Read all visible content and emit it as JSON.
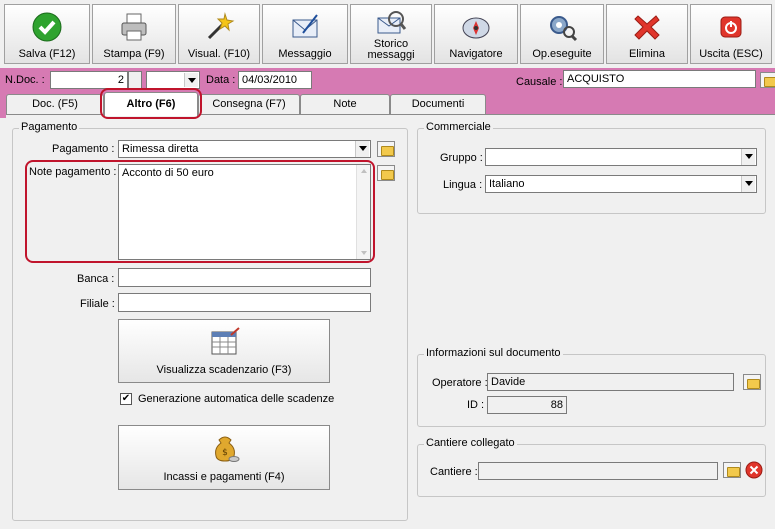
{
  "toolbar": {
    "buttons": [
      {
        "label": "Salva (F12)",
        "icon": "green-check-icon"
      },
      {
        "label": "Stampa (F9)",
        "icon": "printer-icon"
      },
      {
        "label": "Visual. (F10)",
        "icon": "magic-wand-icon"
      },
      {
        "label": "Messaggio",
        "icon": "envelope-icon"
      },
      {
        "label": "Storico\nmessaggi",
        "icon": "message-history-icon"
      },
      {
        "label": "Navigatore",
        "icon": "compass-icon"
      },
      {
        "label": "Op.eseguite",
        "icon": "gears-search-icon"
      },
      {
        "label": "Elimina",
        "icon": "red-x-icon"
      },
      {
        "label": "Uscita (ESC)",
        "icon": "exit-power-icon"
      }
    ]
  },
  "header": {
    "ndoc_label": "N.Doc. :",
    "ndoc_value": "2",
    "data_label": "Data :",
    "data_value": "04/03/2010",
    "causale_label": "Causale :",
    "causale_value": "ACQUISTO"
  },
  "tabs": [
    {
      "label": "Doc. (F5)"
    },
    {
      "label": "Altro (F6)"
    },
    {
      "label": "Consegna (F7)"
    },
    {
      "label": "Note"
    },
    {
      "label": "Documenti"
    }
  ],
  "pagamento": {
    "title": "Pagamento",
    "pagamento_label": "Pagamento :",
    "pagamento_value": "Rimessa diretta",
    "note_label": "Note pagamento :",
    "note_value": "Acconto di 50 euro",
    "banca_label": "Banca :",
    "banca_value": "",
    "filiale_label": "Filiale :",
    "filiale_value": "",
    "scadenzario_button": "Visualizza scadenzario (F3)",
    "generazione_label": "Generazione automatica delle scadenze",
    "generazione_checked": true,
    "incassi_button": "Incassi e pagamenti (F4)"
  },
  "commerciale": {
    "title": "Commerciale",
    "gruppo_label": "Gruppo :",
    "gruppo_value": "",
    "lingua_label": "Lingua :",
    "lingua_value": "Italiano"
  },
  "informazioni": {
    "title": "Informazioni sul documento",
    "operatore_label": "Operatore :",
    "operatore_value": "Davide",
    "id_label": "ID :",
    "id_value": "88"
  },
  "cantiere": {
    "title": "Cantiere collegato",
    "cantiere_label": "Cantiere :",
    "cantiere_value": ""
  },
  "colors": {
    "header_bar": "#d67ab3",
    "highlight": "#c0142c"
  }
}
